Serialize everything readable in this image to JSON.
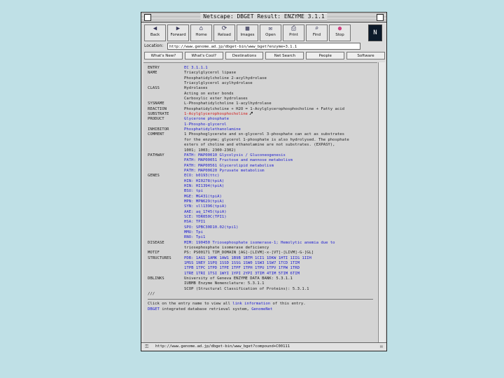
{
  "window": {
    "title": "Netscape: DBGET Result: ENZYME 3.1.1"
  },
  "toolbar": [
    {
      "label": "Back",
      "icon": "◀"
    },
    {
      "label": "Forward",
      "icon": "▶"
    },
    {
      "label": "Home",
      "icon": "⌂"
    },
    {
      "label": "Reload",
      "icon": "⟳"
    },
    {
      "label": "Images",
      "icon": "▦"
    },
    {
      "label": "Open",
      "icon": "✉"
    },
    {
      "label": "Print",
      "icon": "⎙"
    },
    {
      "label": "Find",
      "icon": "⌕"
    },
    {
      "label": "Stop",
      "icon": "●"
    }
  ],
  "location": {
    "label": "Location:",
    "url": "http://www.genome.ad.jp/dbget-bin/www_bget?enzyme+3.1.1"
  },
  "directory_buttons": [
    "What's New?",
    "What's Cool?",
    "Destinations",
    "Net Search",
    "People",
    "Software"
  ],
  "entry": {
    "entry": "EC 3.1.1.1",
    "name_lines": [
      "Triacylglycerol lipase",
      "Phosphatidylcholine 2-acylhydrolase",
      "Triacylglycerol acylhydrolase"
    ],
    "class_lines": [
      "Hydrolases",
      "Acting on ester bonds",
      "Carboxylic ester hydrolases"
    ],
    "sysname": "L-Phosphatidylcholine 1-acylhydrolase",
    "reaction": "Phosphatidylcholine + H2O = 1-Acylglycerophosphocholine + Fatty acid",
    "substrate": "1-Acylglycerophosphocholine",
    "product_lines": [
      "Glycerone phosphate",
      "1-Phospho-glycerol"
    ],
    "inhibitor": "Phosphatidylethanolamine",
    "comment_lines": [
      "1 Phosphoglycerate and sn-glycerol 3-phosphate can act as substrates",
      "for the enzyme; glycerol 1-phosphate is also hydrolysed. The phosphate",
      "esters of choline and ethanolamine are not substrates. (EXPASY),",
      "1001; 1003; 2300-2302)"
    ],
    "pathway_lines": [
      "PATH: MAP00010 Glycolysis / Gluconeogenesis",
      "PATH: MAP00051 Fructose and mannose metabolism",
      "PATH: MAP00561 Glycerolipid metabolism",
      "PATH: MAP00620 Pyruvate metabolism"
    ],
    "genes_lines": [
      "ECO: b0193(ttc)",
      "HIN: HI0278(tpiA)",
      "HIN: HI1394(tpiA)",
      "BSU: tpi",
      "MGE: MG431(tpiA)",
      "MPN: MPN629(tpiA)",
      "SYN: sll1396(tpiA)",
      "AAE: aq_1745(tpiA)",
      "SCE: YDR050C(TPI1)",
      "HSA: TPI1",
      "SPO: SPBC30D10.02(tpi1)",
      "MMU: Tpi",
      "RNO: Tpi1"
    ],
    "disease_lines": [
      "MIM: 190450 Triosephosphate isomerase-1; Hemolytic anemia due to",
      "          triosephosphate isomerase deficiency"
    ],
    "motif": "PS: PS00171 TIM_DOMAIN [AG]-[LIVM]-x-[VT]-[LIVM]-G-[GL]",
    "structures_lines": [
      "PDB: 1AG1 1AMK 1AW1 1B9B 1BTM 1CI1 1DKW 1HTI 1IIG 1IIH",
      "     1MSS 1NEY 1SPQ 1SSD 1SSG 1SW0 1SW3 1SW7 1TCD 1TIM",
      "     1TPB 1TPC 1TPD 1TPE 1TPF 1TPH 1TPU 1TPV 1TPW 1TRD",
      "     1TRE 1TRI 1TSI 1WYI 1YPI 2YPI 3TIM 4TIM 5TIM 6TIM"
    ],
    "dblinks_lines": [
      "University of Geneva ENZYME DATA BANK: 5.3.1.1",
      "IUBMB Enzyme Nomenclature: 5.3.1.1",
      "SCOP (Structural Classification of Proteins): 5.3.1.1"
    ],
    "terminator": "///"
  },
  "labels": {
    "entry": "ENTRY",
    "name": "NAME",
    "class": "CLASS",
    "sysname": "SYSNAME",
    "reaction": "REACTION",
    "substrate": "SUBSTRATE",
    "product": "PRODUCT",
    "inhibitor": "INHIBITOR",
    "comment": "COMMENT",
    "pathway": "PATHWAY",
    "genes": "GENES",
    "disease": "DISEASE",
    "motif": "MOTIF",
    "structures": "STRUCTURES",
    "dblinks": "DBLINKS"
  },
  "footer": {
    "line1_prefix": "Click on the entry name to view all ",
    "line1_link": "link information",
    "line1_suffix": " of this entry.",
    "line2_link": "DBGET",
    "line2_suffix": " integrated database retrieval system, ",
    "line2_link2": "GenomeNet"
  },
  "status": {
    "text": "http://www.genome.ad.jp/dbget-bin/www_bget?compound+C00111"
  },
  "colors": {
    "link": "#1a1ad0",
    "highlight": "#d01818",
    "background": "#bfe0e6"
  }
}
